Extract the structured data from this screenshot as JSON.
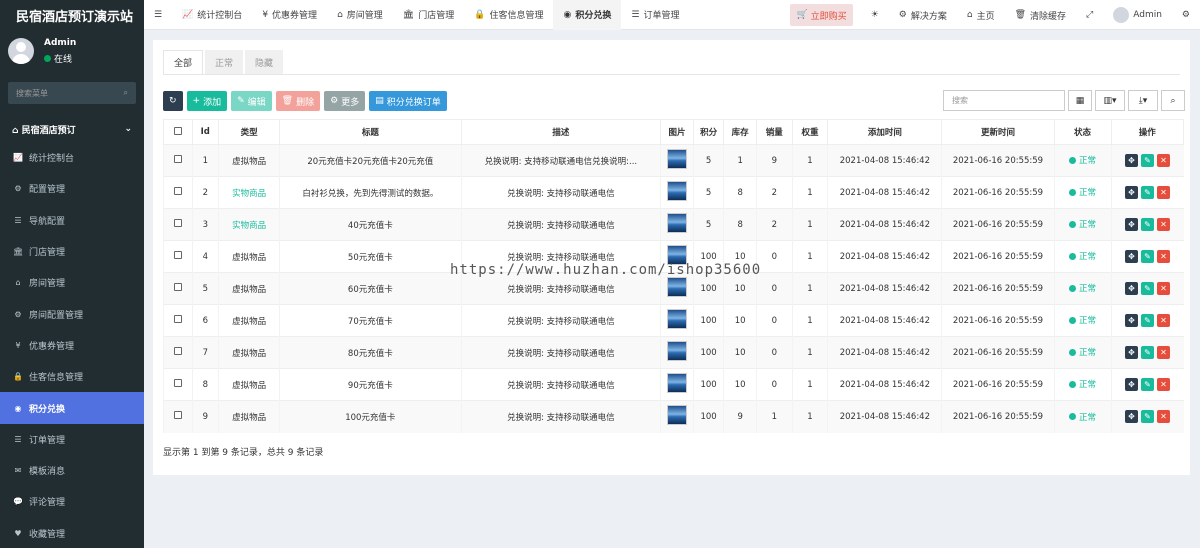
{
  "sidebar": {
    "brand": "民宿酒店预订演示站",
    "user": {
      "name": "Admin",
      "status": "在线"
    },
    "search_placeholder": "搜索菜单",
    "menu_head": "民宿酒店预订",
    "items": [
      {
        "label": "统计控制台",
        "icon": "chart-icon"
      },
      {
        "label": "配置管理",
        "icon": "gear-icon"
      },
      {
        "label": "导航配置",
        "icon": "list-icon"
      },
      {
        "label": "门店管理",
        "icon": "bank-icon"
      },
      {
        "label": "房间管理",
        "icon": "home-icon"
      },
      {
        "label": "房间配置管理",
        "icon": "gear-icon"
      },
      {
        "label": "优惠券管理",
        "icon": "yen-icon"
      },
      {
        "label": "住客信息管理",
        "icon": "lock-icon"
      },
      {
        "label": "积分兑换",
        "icon": "dashboard-icon",
        "active": true
      },
      {
        "label": "订单管理",
        "icon": "list-icon"
      },
      {
        "label": "模板消息",
        "icon": "envelope-icon"
      },
      {
        "label": "评论管理",
        "icon": "comments-icon"
      },
      {
        "label": "收藏管理",
        "icon": "heart-icon"
      }
    ]
  },
  "topbar": {
    "nav": [
      {
        "label": "统计控制台",
        "icon": "chart-icon"
      },
      {
        "label": "优惠券管理",
        "icon": "yen-icon"
      },
      {
        "label": "房间管理",
        "icon": "home-icon"
      },
      {
        "label": "门店管理",
        "icon": "bank-icon"
      },
      {
        "label": "住客信息管理",
        "icon": "lock-icon"
      },
      {
        "label": "积分兑换",
        "icon": "dashboard-icon",
        "active": true
      },
      {
        "label": "订单管理",
        "icon": "list-icon"
      }
    ],
    "buy": "立即购买",
    "solutions": "解决方案",
    "home": "主页",
    "clear_cache": "清除缓存",
    "admin": "Admin"
  },
  "tabs": [
    "全部",
    "正常",
    "隐藏"
  ],
  "toolbar": {
    "add": "添加",
    "edit": "编辑",
    "delete": "删除",
    "more": "更多",
    "orders": "积分兑换订单",
    "search_placeholder": "搜索"
  },
  "table": {
    "headers": [
      "Id",
      "类型",
      "标题",
      "描述",
      "图片",
      "积分",
      "库存",
      "销量",
      "权重",
      "添加时间",
      "更新时间",
      "状态",
      "操作"
    ],
    "rows": [
      {
        "id": "1",
        "type": "虚拟物品",
        "title": "20元充值卡20元充值卡20元充值",
        "desc": "兑换说明: 支持移动联通电信兑换说明:...",
        "points": "5",
        "stock": "1",
        "sales": "9",
        "weight": "1",
        "created": "2021-04-08 15:46:42",
        "updated": "2021-06-16 20:55:59",
        "status": "正常"
      },
      {
        "id": "2",
        "type": "实物商品",
        "title": "白衬衫兑换，先到先得测试的数据。",
        "desc": "兑换说明: 支持移动联通电信",
        "points": "5",
        "stock": "8",
        "sales": "2",
        "weight": "1",
        "created": "2021-04-08 15:46:42",
        "updated": "2021-06-16 20:55:59",
        "status": "正常"
      },
      {
        "id": "3",
        "type": "实物商品",
        "title": "40元充值卡",
        "desc": "兑换说明: 支持移动联通电信",
        "points": "5",
        "stock": "8",
        "sales": "2",
        "weight": "1",
        "created": "2021-04-08 15:46:42",
        "updated": "2021-06-16 20:55:59",
        "status": "正常"
      },
      {
        "id": "4",
        "type": "虚拟物品",
        "title": "50元充值卡",
        "desc": "兑换说明: 支持移动联通电信",
        "points": "100",
        "stock": "10",
        "sales": "0",
        "weight": "1",
        "created": "2021-04-08 15:46:42",
        "updated": "2021-06-16 20:55:59",
        "status": "正常"
      },
      {
        "id": "5",
        "type": "虚拟物品",
        "title": "60元充值卡",
        "desc": "兑换说明: 支持移动联通电信",
        "points": "100",
        "stock": "10",
        "sales": "0",
        "weight": "1",
        "created": "2021-04-08 15:46:42",
        "updated": "2021-06-16 20:55:59",
        "status": "正常"
      },
      {
        "id": "6",
        "type": "虚拟物品",
        "title": "70元充值卡",
        "desc": "兑换说明: 支持移动联通电信",
        "points": "100",
        "stock": "10",
        "sales": "0",
        "weight": "1",
        "created": "2021-04-08 15:46:42",
        "updated": "2021-06-16 20:55:59",
        "status": "正常"
      },
      {
        "id": "7",
        "type": "虚拟物品",
        "title": "80元充值卡",
        "desc": "兑换说明: 支持移动联通电信",
        "points": "100",
        "stock": "10",
        "sales": "0",
        "weight": "1",
        "created": "2021-04-08 15:46:42",
        "updated": "2021-06-16 20:55:59",
        "status": "正常"
      },
      {
        "id": "8",
        "type": "虚拟物品",
        "title": "90元充值卡",
        "desc": "兑换说明: 支持移动联通电信",
        "points": "100",
        "stock": "10",
        "sales": "0",
        "weight": "1",
        "created": "2021-04-08 15:46:42",
        "updated": "2021-06-16 20:55:59",
        "status": "正常"
      },
      {
        "id": "9",
        "type": "虚拟物品",
        "title": "100元充值卡",
        "desc": "兑换说明: 支持移动联通电信",
        "points": "100",
        "stock": "9",
        "sales": "1",
        "weight": "1",
        "created": "2021-04-08 15:46:42",
        "updated": "2021-06-16 20:55:59",
        "status": "正常"
      }
    ]
  },
  "summary": "显示第 1 到第 9 条记录，总共 9 条记录",
  "watermark": "https://www.huzhan.com/ishop35600",
  "colors": {
    "sidebar_bg": "#222d32",
    "active": "#5171e0",
    "green": "#18bc9c",
    "red": "#e74c3c",
    "dark": "#2c3e50"
  }
}
